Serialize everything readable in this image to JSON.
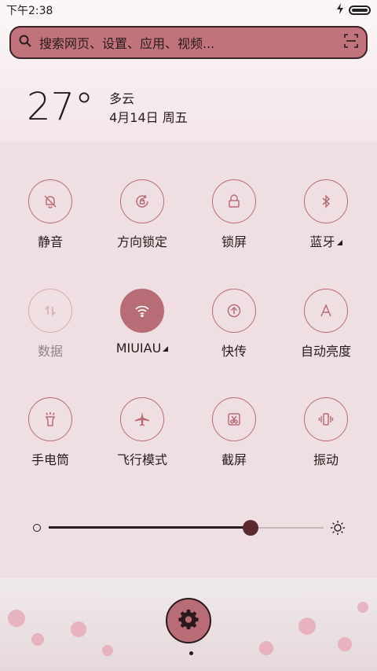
{
  "status_bar": {
    "time": "下午2:38"
  },
  "search": {
    "placeholder": "搜索网页、设置、应用、视频..."
  },
  "weather": {
    "temperature": "27°",
    "condition": "多云",
    "date": "4月14日 周五"
  },
  "tiles": [
    {
      "label": "静音",
      "icon": "bell-off-icon"
    },
    {
      "label": "方向锁定",
      "icon": "rotation-lock-icon"
    },
    {
      "label": "锁屏",
      "icon": "lock-icon"
    },
    {
      "label": "蓝牙",
      "icon": "bluetooth-icon"
    },
    {
      "label": "数据",
      "icon": "mobile-data-icon",
      "state": "disabled"
    },
    {
      "label": "MIUIAU",
      "icon": "wifi-icon",
      "state": "active"
    },
    {
      "label": "快传",
      "icon": "upload-icon"
    },
    {
      "label": "自动亮度",
      "icon": "auto-brightness-icon"
    },
    {
      "label": "手电筒",
      "icon": "flashlight-icon"
    },
    {
      "label": "飞行模式",
      "icon": "airplane-icon"
    },
    {
      "label": "截屏",
      "icon": "screenshot-icon"
    },
    {
      "label": "振动",
      "icon": "vibrate-icon"
    }
  ],
  "brightness": {
    "level": 0.735
  },
  "colors": {
    "accent": "#b86d76",
    "dark": "#2a1a1d",
    "panel": "#f0dfe2"
  }
}
